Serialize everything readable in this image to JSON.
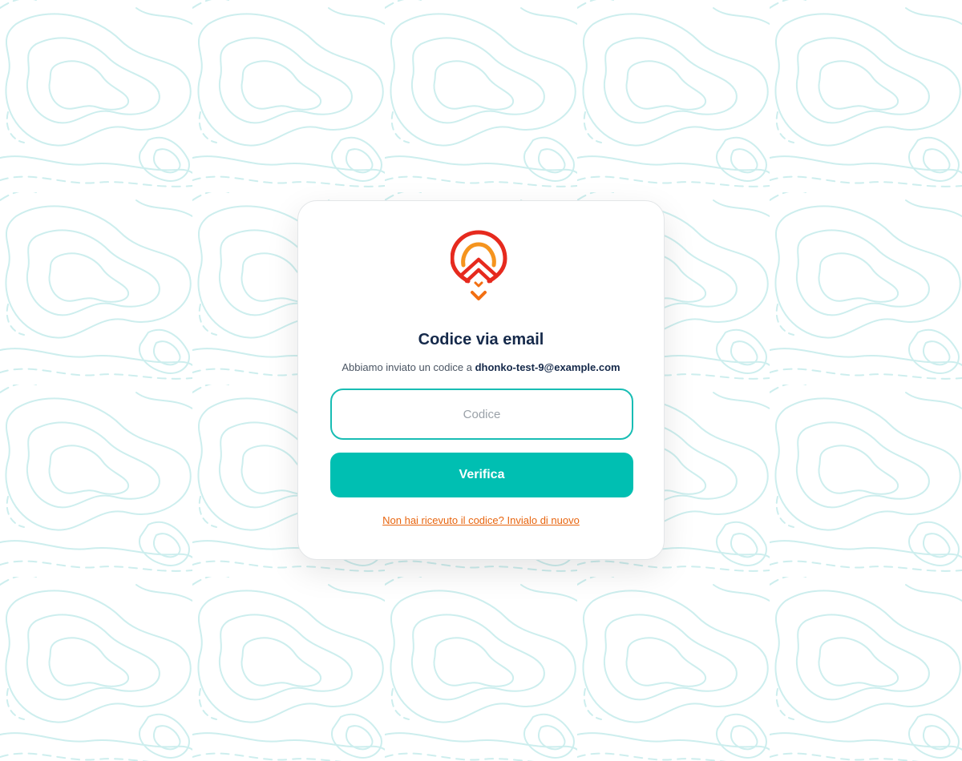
{
  "brand": {
    "logo_icon": "location-pin-chevron-icon",
    "color_ring": "#e62a1e",
    "color_inner": "#f5941e",
    "color_arrow": "#f26f12"
  },
  "card": {
    "title": "Codice via email",
    "subtitle_prefix": "Abbiamo inviato un codice a",
    "email": "dhonko-test-9@example.com",
    "code_input": {
      "placeholder": "Codice",
      "value": ""
    },
    "verify_label": "Verifica",
    "resend_label": "Non hai ricevuto il codice? Invialo di nuovo"
  },
  "colors": {
    "accent": "#00bfb2",
    "title": "#15294a",
    "link": "#e8650f",
    "background_pattern": "#c9eeee"
  }
}
